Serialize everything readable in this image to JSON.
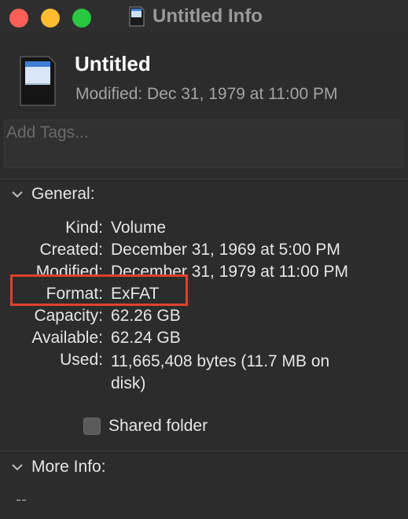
{
  "window": {
    "title": "Untitled Info"
  },
  "header": {
    "name": "Untitled",
    "modified": "Modified: Dec 31, 1979 at 11:00 PM"
  },
  "tags": {
    "placeholder": "Add Tags..."
  },
  "general": {
    "section_label": "General:",
    "rows": [
      {
        "label": "Kind:",
        "value": "Volume"
      },
      {
        "label": "Created:",
        "value": "December 31, 1969 at 5:00 PM"
      },
      {
        "label": "Modified:",
        "value": "December 31, 1979 at 11:00 PM"
      },
      {
        "label": "Format:",
        "value": "ExFAT"
      },
      {
        "label": "Capacity:",
        "value": "62.26 GB"
      },
      {
        "label": "Available:",
        "value": "62.24 GB"
      },
      {
        "label": "Used:",
        "value": "11,665,408 bytes (11.7 MB on disk)"
      }
    ],
    "shared_folder_label": "Shared folder",
    "shared_folder_checked": false
  },
  "more_info": {
    "section_label": "More Info:",
    "value": "--"
  },
  "colors": {
    "close": "#ff5f57",
    "minimize": "#febc2e",
    "zoom": "#28c840",
    "highlight": "#e0422b",
    "background": "#2c2c2c"
  },
  "icons": {
    "title": "sd-card-icon",
    "file": "sd-card-icon",
    "section_toggle": "chevron-down-icon"
  }
}
